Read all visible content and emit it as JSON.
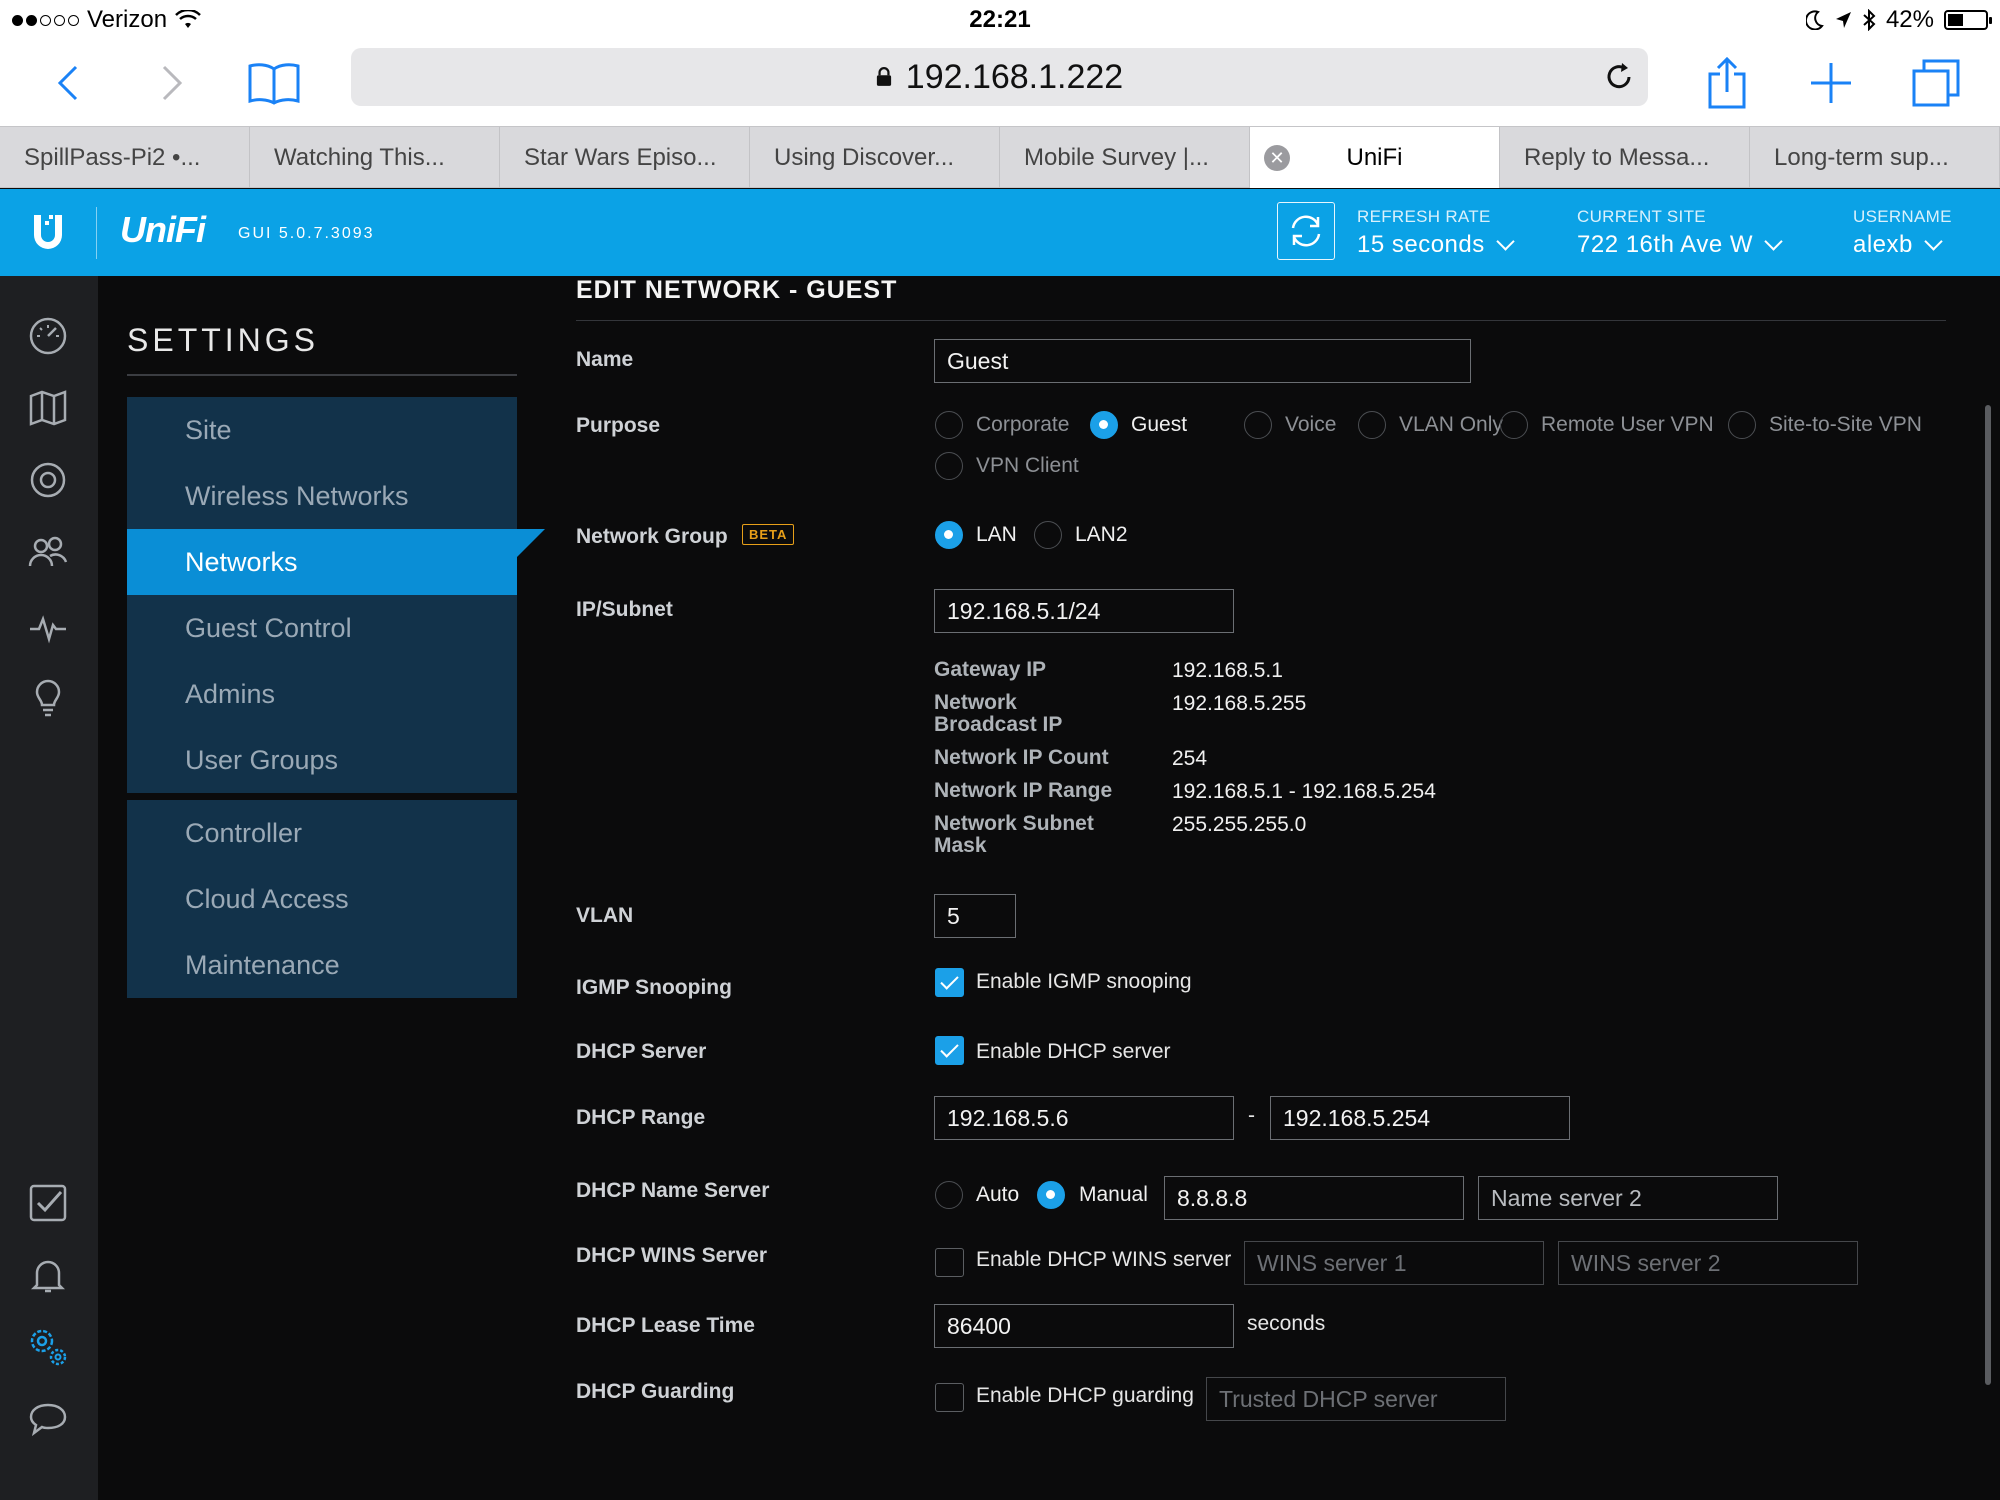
{
  "status_bar": {
    "carrier": "Verizon",
    "time": "22:21",
    "battery": "42%",
    "battery_level": 0.42
  },
  "browser": {
    "url": "192.168.1.222",
    "tabs": [
      {
        "label": "SpillPass-Pi2 •..."
      },
      {
        "label": "Watching This..."
      },
      {
        "label": "Star Wars Episo..."
      },
      {
        "label": "Using Discover..."
      },
      {
        "label": "Mobile Survey |..."
      },
      {
        "label": "UniFi",
        "active": true
      },
      {
        "label": "Reply to Messa..."
      },
      {
        "label": "Long-term sup..."
      }
    ]
  },
  "header": {
    "logo": "UniFi",
    "gui_version": "GUI 5.0.7.3093",
    "refresh_label": "REFRESH RATE",
    "refresh_value": "15 seconds",
    "site_label": "CURRENT SITE",
    "site_value": "722 16th Ave W",
    "user_label": "USERNAME",
    "user_value": "alexb"
  },
  "rail_icons": [
    "dashboard-icon",
    "map-icon",
    "devices-icon",
    "clients-icon",
    "statistics-icon",
    "insights-icon",
    "tasks-icon",
    "alerts-icon",
    "settings-icon",
    "chat-icon"
  ],
  "settings": {
    "title": "SETTINGS",
    "group1": [
      "Site",
      "Wireless Networks",
      "Networks",
      "Guest Control",
      "Admins",
      "User Groups"
    ],
    "group2": [
      "Controller",
      "Cloud Access",
      "Maintenance"
    ],
    "active": "Networks"
  },
  "form": {
    "title": "EDIT NETWORK - GUEST",
    "name_label": "Name",
    "name_value": "Guest",
    "purpose_label": "Purpose",
    "purpose_options": [
      "Corporate",
      "Guest",
      "Voice",
      "VLAN Only",
      "Remote User VPN",
      "Site-to-Site VPN",
      "VPN Client"
    ],
    "purpose_selected": "Guest",
    "group_label": "Network Group",
    "beta": "BETA",
    "group_options": [
      "LAN",
      "LAN2"
    ],
    "group_selected": "LAN",
    "subnet_label": "IP/Subnet",
    "subnet_value": "192.168.5.1/24",
    "info": {
      "gateway_k": "Gateway IP",
      "gateway_v": "192.168.5.1",
      "broadcast_k": "Network Broadcast IP",
      "broadcast_v": "192.168.5.255",
      "count_k": "Network IP Count",
      "count_v": "254",
      "range_k": "Network IP Range",
      "range_v": "192.168.5.1 - 192.168.5.254",
      "mask_k": "Network Subnet Mask",
      "mask_v": "255.255.255.0"
    },
    "vlan_label": "VLAN",
    "vlan_value": "5",
    "igmp_label": "IGMP Snooping",
    "igmp_check": "Enable IGMP snooping",
    "dhcp_label": "DHCP Server",
    "dhcp_check": "Enable DHCP server",
    "range_label": "DHCP Range",
    "range_start": "192.168.5.6",
    "range_sep": "-",
    "range_end": "192.168.5.254",
    "ns_label": "DHCP Name Server",
    "ns_auto": "Auto",
    "ns_manual": "Manual",
    "ns1": "8.8.8.8",
    "ns2_placeholder": "Name server 2",
    "wins_label": "DHCP WINS Server",
    "wins_check": "Enable DHCP WINS server",
    "wins1_placeholder": "WINS server 1",
    "wins2_placeholder": "WINS server 2",
    "lease_label": "DHCP Lease Time",
    "lease_value": "86400",
    "lease_unit": "seconds",
    "guard_label": "DHCP Guarding",
    "guard_check": "Enable DHCP guarding",
    "guard_placeholder": "Trusted DHCP server"
  },
  "colors": {
    "accent": "#0ba2e6",
    "menu_bg": "#12324a",
    "beta": "#e79f19"
  }
}
